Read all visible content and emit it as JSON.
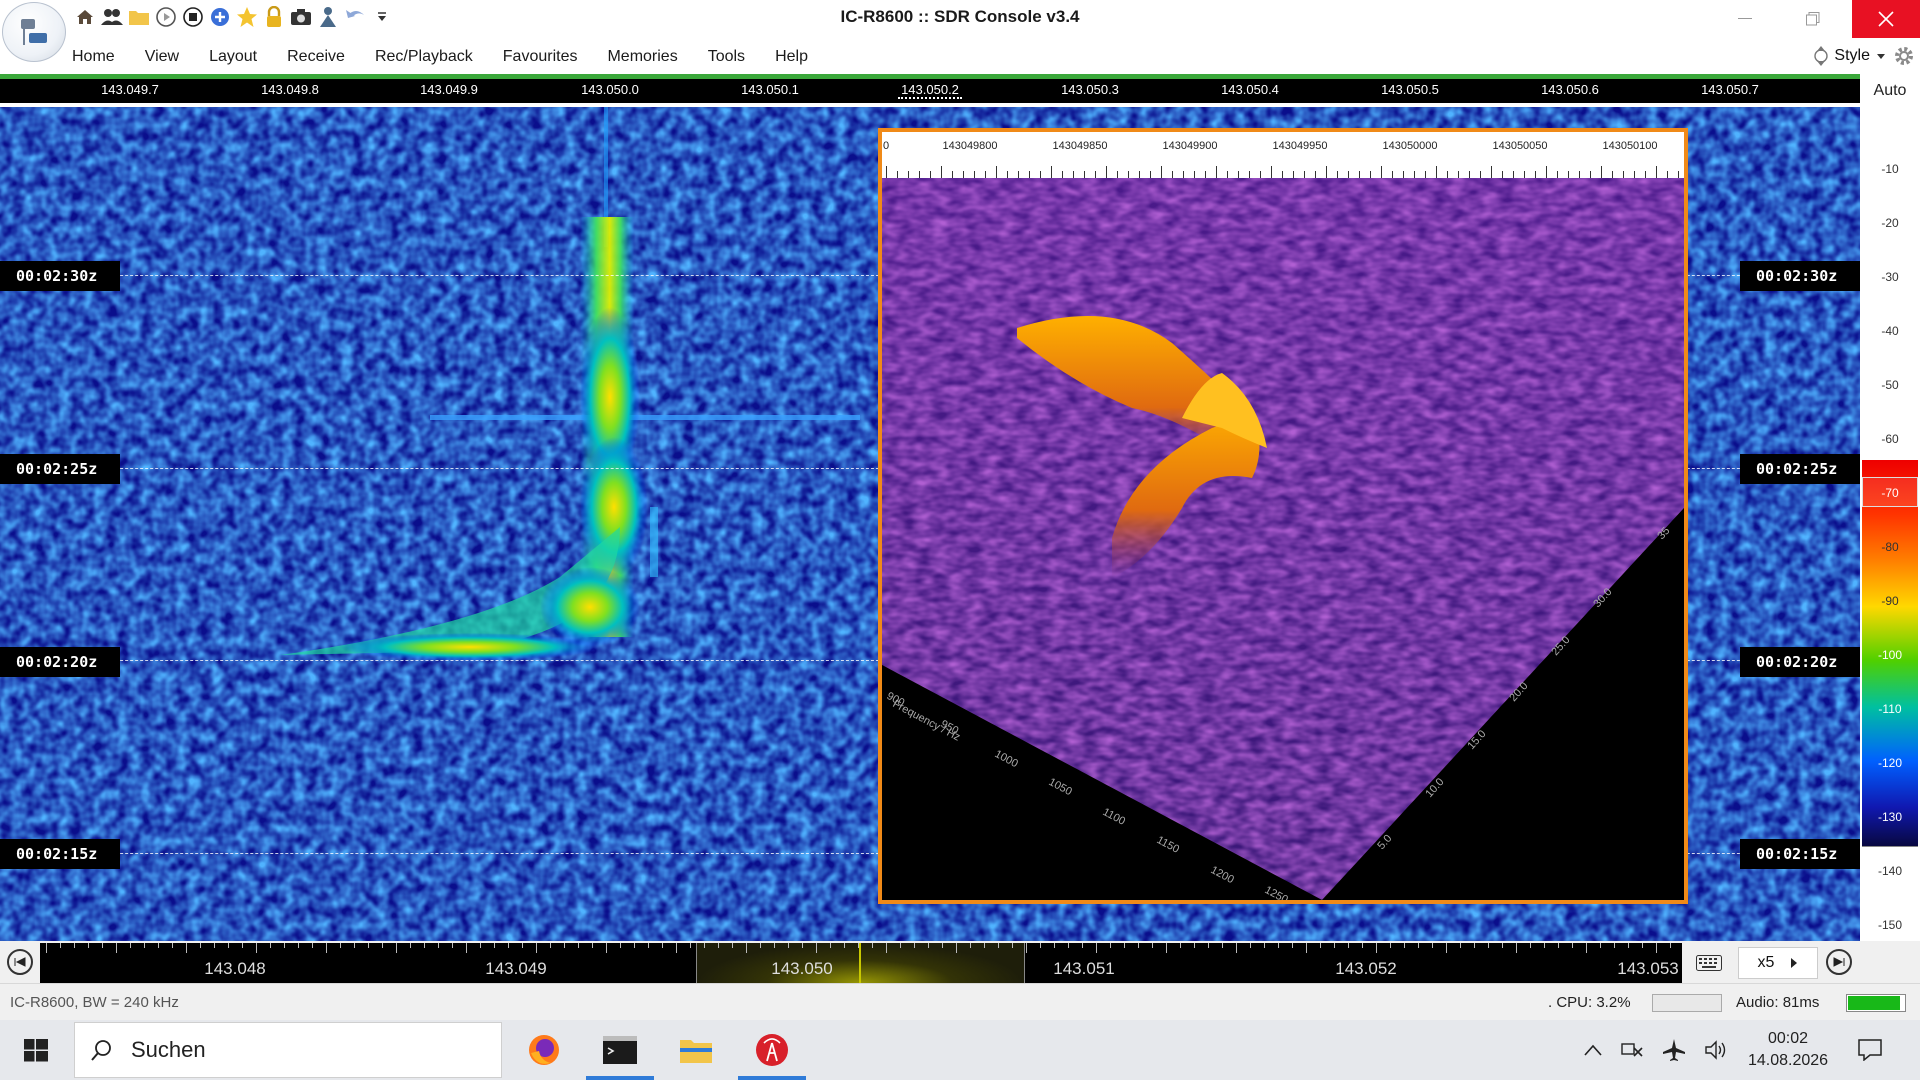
{
  "window": {
    "title": "IC-R8600 :: SDR Console v3.4",
    "quick_access_icons": [
      "home-icon",
      "users-icon",
      "folder-icon",
      "play-icon",
      "stop-icon",
      "add-icon",
      "favourite-star-icon",
      "lock-icon",
      "camera-icon",
      "person-icon",
      "undo-icon",
      "dropdown-icon"
    ]
  },
  "menu": {
    "items": [
      "Home",
      "View",
      "Layout",
      "Receive",
      "Rec/Playback",
      "Favourites",
      "Memories",
      "Tools",
      "Help"
    ],
    "style_label": "Style"
  },
  "frequency_scale": {
    "labels": [
      "143.049.7",
      "143.049.8",
      "143.049.9",
      "143.050.0",
      "143.050.1",
      "143.050.2",
      "143.050.3",
      "143.050.4",
      "143.050.5",
      "143.050.6",
      "143.050.7"
    ]
  },
  "waterfall": {
    "time_labels": [
      "00:02:30z",
      "00:02:25z",
      "00:02:20z",
      "00:02:15z"
    ]
  },
  "db_scale": {
    "mode": "Auto",
    "values": [
      "-10",
      "-20",
      "-30",
      "-40",
      "-50",
      "-60",
      "-70",
      "-80",
      "-90",
      "-100",
      "-110",
      "-120",
      "-130",
      "-140",
      "-150"
    ]
  },
  "overlay_3d": {
    "ruler_labels": [
      "0",
      "143049800",
      "143049850",
      "143049900",
      "143049950",
      "143050000",
      "143050050",
      "143050100"
    ],
    "freq_axis_title": "Frequency / Hz",
    "freq_axis_ticks": [
      "900",
      "950",
      "1000",
      "1050",
      "1100",
      "1150",
      "1200",
      "1250"
    ],
    "time_axis_ticks": [
      "5.0",
      "10.0",
      "15.0",
      "20.0",
      "25.0",
      "30.0",
      "35"
    ]
  },
  "tuner": {
    "freq_labels": [
      "143.048",
      "143.049",
      "143.050",
      "143.051",
      "143.052",
      "143.053"
    ],
    "zoom_label": "x5"
  },
  "status": {
    "radio_info": "IC-R8600, BW = 240 kHz",
    "cpu": ". CPU: 3.2%",
    "audio": "Audio: 81ms",
    "audio_level": 0.92
  },
  "taskbar": {
    "search_placeholder": "Suchen",
    "time": "00:02",
    "date": "14.08.2026"
  },
  "colors": {
    "accent_close": "#e81123",
    "overlay_border": "#f08a18",
    "signal_green": "#3aa83a"
  }
}
